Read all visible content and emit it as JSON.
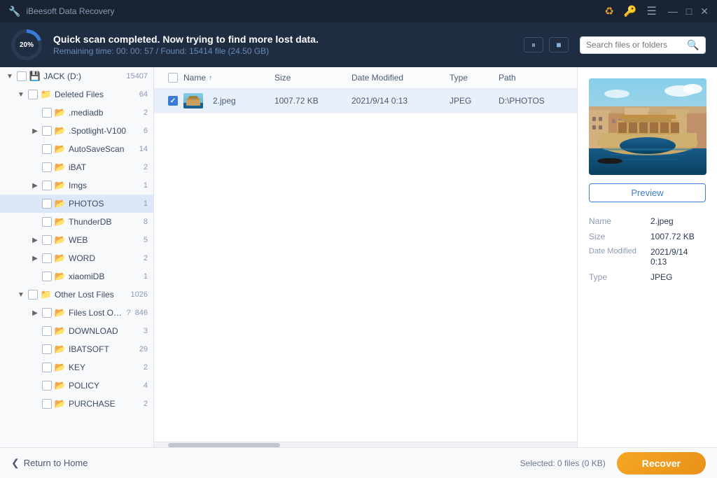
{
  "app": {
    "title": "iBeesoft Data Recovery",
    "title_icon": "🔧"
  },
  "titlebar": {
    "icons": [
      "🔁",
      "🔑"
    ],
    "win_minimize": "—",
    "win_restore": "□",
    "win_close": "✕"
  },
  "scan_banner": {
    "progress_percent": "20%",
    "title": "Quick scan completed. Now trying to find more lost data.",
    "subtitle": "Remaining time: 00: 00: 57 / Found: 15414 file (24.50 GB)",
    "pause_btn": "⏸",
    "stop_btn": "⏹",
    "search_placeholder": "Search files or folders"
  },
  "sidebar": {
    "items": [
      {
        "label": "JACK (D:)",
        "count": "15407",
        "indent": 0,
        "icon": "drive",
        "expanded": true,
        "checked": false
      },
      {
        "label": "Deleted Files",
        "count": "64",
        "indent": 1,
        "icon": "folder-orange",
        "expanded": true,
        "checked": false
      },
      {
        "label": ".mediadb",
        "count": "2",
        "indent": 2,
        "icon": "folder-blue",
        "expanded": false,
        "checked": false
      },
      {
        "label": ".Spotlight-V100",
        "count": "6",
        "indent": 2,
        "icon": "folder-blue",
        "expanded": false,
        "checked": false
      },
      {
        "label": "AutoSaveScan",
        "count": "14",
        "indent": 2,
        "icon": "folder-blue",
        "expanded": false,
        "checked": false
      },
      {
        "label": "iBAT",
        "count": "2",
        "indent": 2,
        "icon": "folder-blue",
        "expanded": false,
        "checked": false
      },
      {
        "label": "Imgs",
        "count": "1",
        "indent": 2,
        "icon": "folder-blue",
        "expanded": false,
        "checked": false
      },
      {
        "label": "PHOTOS",
        "count": "1",
        "indent": 2,
        "icon": "folder-blue",
        "expanded": false,
        "checked": false,
        "selected": true
      },
      {
        "label": "ThunderDB",
        "count": "8",
        "indent": 2,
        "icon": "folder-blue",
        "expanded": false,
        "checked": false
      },
      {
        "label": "WEB",
        "count": "5",
        "indent": 2,
        "icon": "folder-blue",
        "expanded": false,
        "checked": false
      },
      {
        "label": "WORD",
        "count": "2",
        "indent": 2,
        "icon": "folder-blue",
        "expanded": false,
        "checked": false
      },
      {
        "label": "xiaomiDB",
        "count": "1",
        "indent": 2,
        "icon": "folder-blue",
        "expanded": false,
        "checked": false
      },
      {
        "label": "Other Lost Files",
        "count": "1026",
        "indent": 1,
        "icon": "folder-orange",
        "expanded": true,
        "checked": false
      },
      {
        "label": "Files Lost Origi...",
        "count": "846",
        "indent": 2,
        "icon": "folder-blue",
        "expanded": false,
        "checked": false,
        "has_info": true
      },
      {
        "label": "DOWNLOAD",
        "count": "3",
        "indent": 2,
        "icon": "folder-blue",
        "expanded": false,
        "checked": false
      },
      {
        "label": "IBATSOFT",
        "count": "29",
        "indent": 2,
        "icon": "folder-blue",
        "expanded": false,
        "checked": false
      },
      {
        "label": "KEY",
        "count": "2",
        "indent": 2,
        "icon": "folder-blue",
        "expanded": false,
        "checked": false
      },
      {
        "label": "POLICY",
        "count": "4",
        "indent": 2,
        "icon": "folder-blue",
        "expanded": false,
        "checked": false
      },
      {
        "label": "PURCHASE",
        "count": "2",
        "indent": 2,
        "icon": "folder-blue",
        "expanded": false,
        "checked": false
      }
    ]
  },
  "file_list": {
    "columns": [
      "Name",
      "Size",
      "Date Modified",
      "Type",
      "Path"
    ],
    "rows": [
      {
        "name": "2.jpeg",
        "size": "1007.72 KB",
        "date": "2021/9/14 0:13",
        "type": "JPEG",
        "path": "D:\\PHOTOS",
        "checked": true
      }
    ]
  },
  "preview": {
    "button_label": "Preview",
    "meta": {
      "name_label": "Name",
      "name_value": "2.jpeg",
      "size_label": "Size",
      "size_value": "1007.72 KB",
      "date_label": "Date Modified",
      "date_value": "2021/9/14 0:13",
      "type_label": "Type",
      "type_value": "JPEG"
    }
  },
  "bottom_bar": {
    "return_label": "Return to Home",
    "selected_info": "Selected: 0 files (0 KB)",
    "recover_label": "Recover"
  }
}
